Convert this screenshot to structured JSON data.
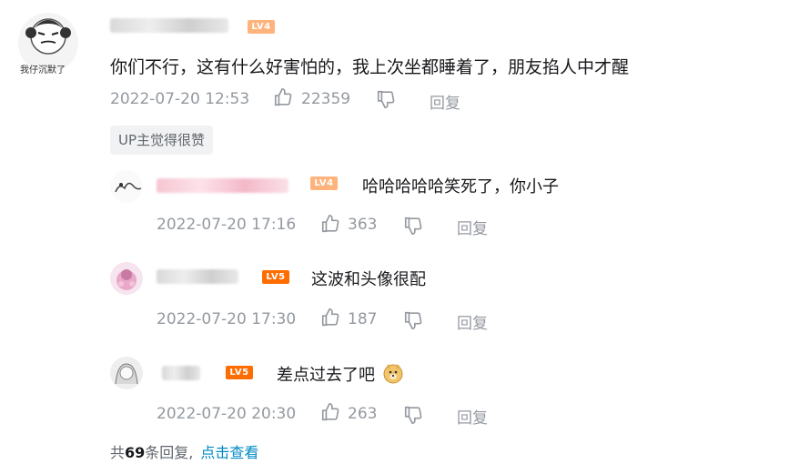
{
  "main_comment": {
    "avatar_caption": "我仔沉默了",
    "level": "LV4",
    "content": "你们不行，这有什么好害怕的，我上次坐都睡着了，朋友掐人中才醒",
    "time": "2022-07-20 12:53",
    "likes": "22359",
    "reply_label": "回复",
    "up_badge": "UP主觉得很赞"
  },
  "replies": [
    {
      "level": "LV4",
      "content": "哈哈哈哈哈笑死了，你小子",
      "time": "2022-07-20 17:16",
      "likes": "363",
      "reply_label": "回复"
    },
    {
      "level": "LV5",
      "content": "这波和头像很配",
      "time": "2022-07-20 17:30",
      "likes": "187",
      "reply_label": "回复"
    },
    {
      "level": "LV5",
      "content": "差点过去了吧",
      "time": "2022-07-20 20:30",
      "likes": "263",
      "reply_label": "回复"
    }
  ],
  "footer": {
    "prefix": "共",
    "count": "69",
    "suffix": "条回复,",
    "view_more": "点击查看"
  },
  "colors": {
    "lv4": "#ffb37c",
    "lv5": "#ff6c00",
    "link": "#008ac5",
    "meta": "#9499a0"
  }
}
